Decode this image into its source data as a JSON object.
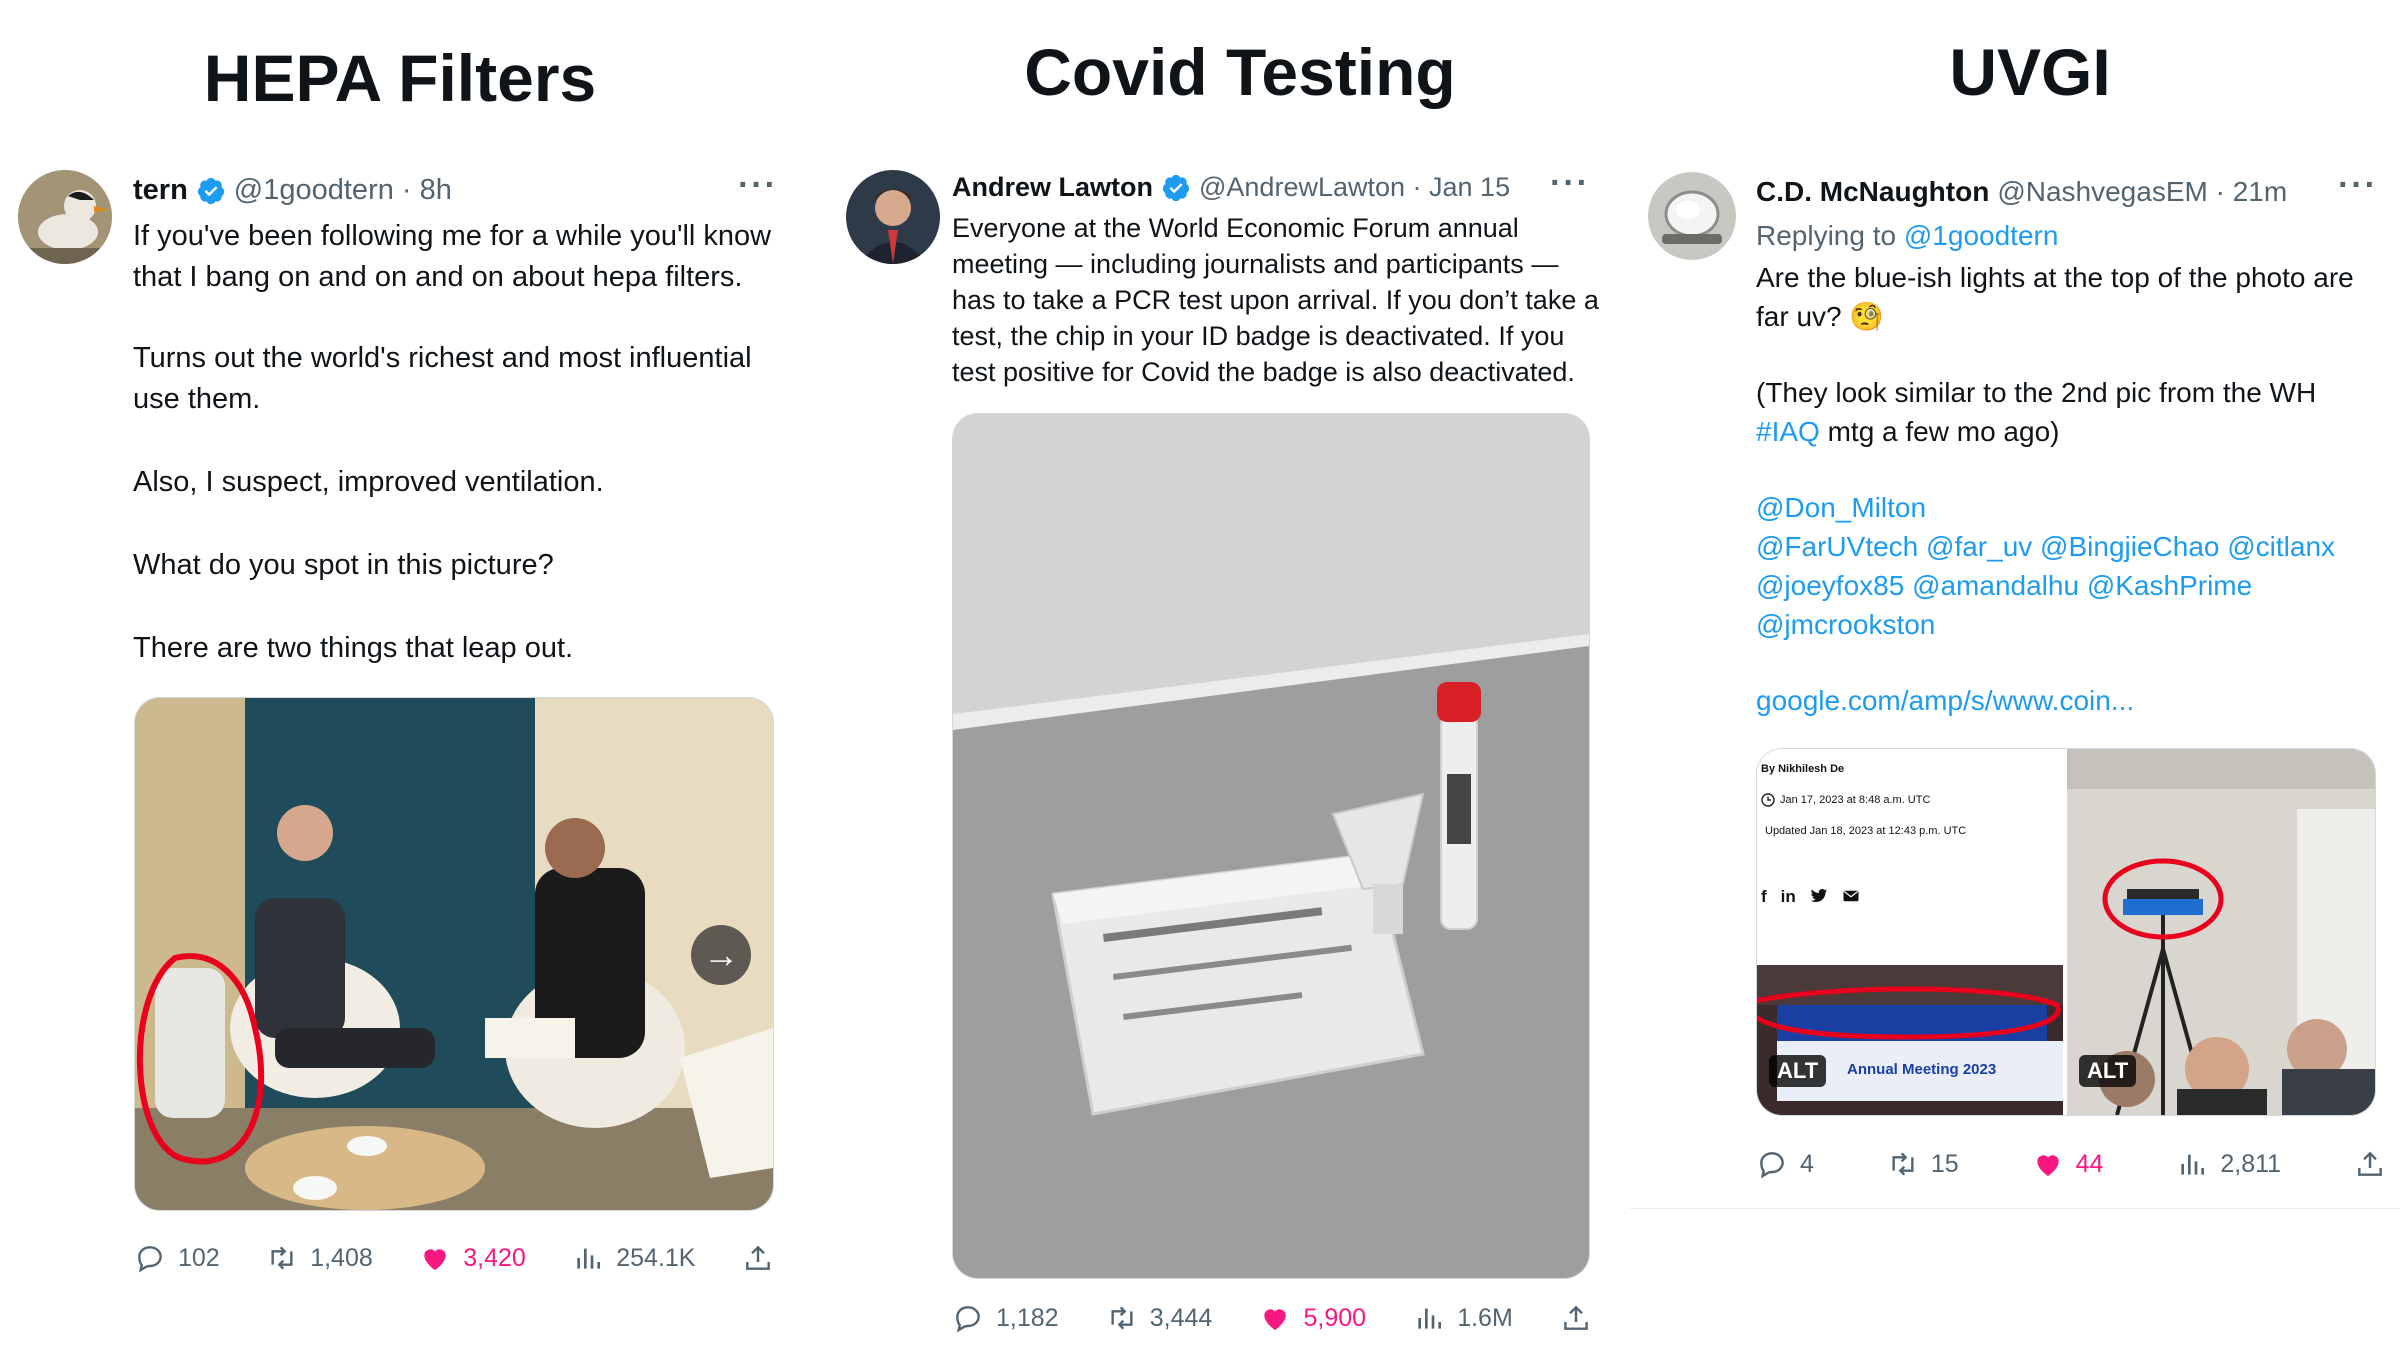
{
  "columns": {
    "hepa": "HEPA Filters",
    "covid": "Covid Testing",
    "uvgi": "UVGI"
  },
  "colors": {
    "link": "#1d9bf0",
    "like": "#f91880",
    "muted": "#536471",
    "circle": "#e8001c"
  },
  "tweet1": {
    "name": "tern",
    "handle": "@1goodtern · 8h",
    "paragraphs": [
      "If you've been following me for a while you'll know that I bang on and on and on about hepa filters.",
      "Turns out the world's richest and most influential use them.",
      "Also, I suspect, improved ventilation.",
      "What do you spot in this picture?",
      "There are two things that leap out."
    ],
    "replies": "102",
    "retweets": "1,408",
    "likes": "3,420",
    "views": "254.1K"
  },
  "tweet2": {
    "name": "Andrew Lawton",
    "handle": "@AndrewLawton · Jan 15",
    "text": "Everyone at the World Economic Forum annual meeting — including journalists and participants — has to take a PCR test upon arrival. If you don’t take a test, the chip in your ID badge is deactivated. If you test positive for Covid the badge is also deactivated.",
    "replies": "1,182",
    "retweets": "3,444",
    "likes": "5,900",
    "views": "1.6M"
  },
  "tweet3": {
    "name": "C.D. McNaughton",
    "handle": "@NashvegasEM · 21m",
    "replying_prefix": "Replying to",
    "replying_to": "@1goodtern",
    "text1": "Are the blue-ish lights at the top of the photo are far uv? 🧐",
    "text2_pre": "(They look similar to the 2nd pic from the WH",
    "hashtag": "#IAQ",
    "text2_post": "mtg a few mo ago)",
    "mentions_line1": "@Don_Milton",
    "mentions_line2": "@FarUVtech @far_uv @BingjieChao @citlanx",
    "mentions_line3": "@joeyfox85 @amandalhu @KashPrime",
    "mentions_line4": "@jmcrookston",
    "url": "google.com/amp/s/www.coin...",
    "media_left": {
      "byline": "By Nikhilesh De",
      "date": "Jan 17, 2023 at 8:48 a.m. UTC",
      "updated": "Updated Jan 18, 2023 at 12:43 p.m. UTC",
      "banner": "Annual Meeting 2023",
      "alt": "ALT"
    },
    "media_right_alt": "ALT",
    "replies": "4",
    "retweets": "15",
    "likes": "44",
    "views": "2,811"
  }
}
